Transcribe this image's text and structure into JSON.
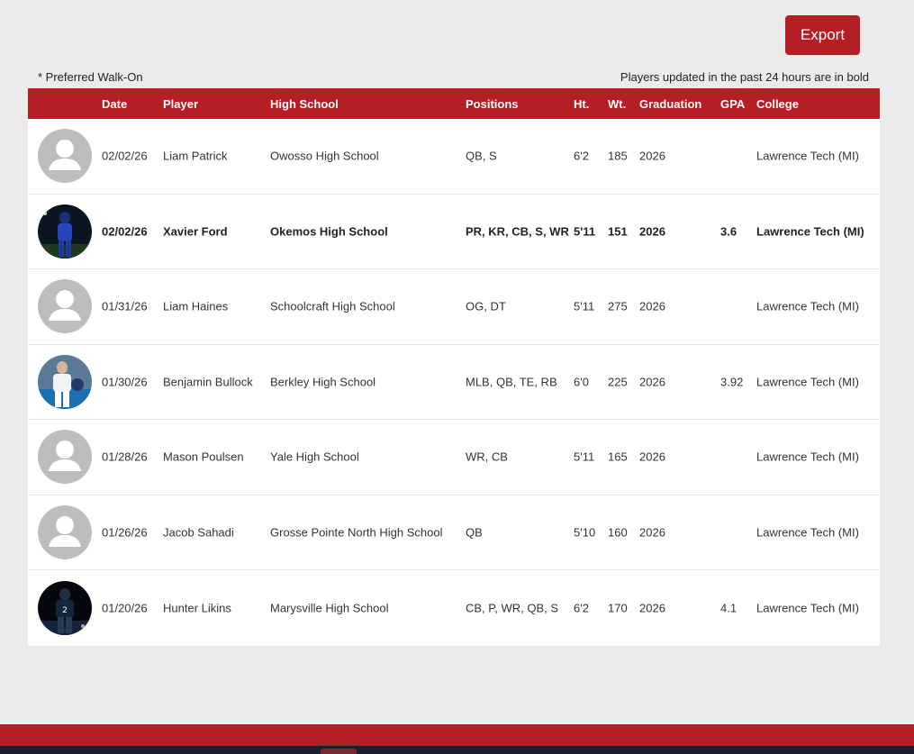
{
  "toolbar": {
    "export_label": "Export"
  },
  "notes": {
    "left": "* Preferred Walk-On",
    "right": "Players updated in the past 24 hours are in bold"
  },
  "table": {
    "headers": {
      "date": "Date",
      "player": "Player",
      "school": "High School",
      "positions": "Positions",
      "ht": "Ht.",
      "wt": "Wt.",
      "graduation": "Graduation",
      "gpa": "GPA",
      "college": "College"
    },
    "rows": [
      {
        "photo": "placeholder",
        "date": "02/02/26",
        "player": "Liam Patrick",
        "school": "Owosso High School",
        "positions": "QB, S",
        "ht": "6'2",
        "wt": "185",
        "graduation": "2026",
        "gpa": "",
        "college": "Lawrence Tech (MI)",
        "bold": false
      },
      {
        "photo": "photo-night-field-blue",
        "date": "02/02/26",
        "player": "Xavier Ford",
        "school": "Okemos High School",
        "positions": "PR, KR, CB, S, WR",
        "ht": "5'11",
        "wt": "151",
        "graduation": "2026",
        "gpa": "3.6",
        "college": "Lawrence Tech (MI)",
        "bold": true
      },
      {
        "photo": "placeholder",
        "date": "01/31/26",
        "player": "Liam Haines",
        "school": "Schoolcraft High School",
        "positions": "OG, DT",
        "ht": "5'11",
        "wt": "275",
        "graduation": "2026",
        "gpa": "",
        "college": "Lawrence Tech (MI)",
        "bold": false
      },
      {
        "photo": "photo-day-white-uniform",
        "date": "01/30/26",
        "player": "Benjamin Bullock",
        "school": "Berkley High School",
        "positions": "MLB, QB, TE, RB",
        "ht": "6'0",
        "wt": "225",
        "graduation": "2026",
        "gpa": "3.92",
        "college": "Lawrence Tech (MI)",
        "bold": false
      },
      {
        "photo": "placeholder",
        "date": "01/28/26",
        "player": "Mason Poulsen",
        "school": "Yale High School",
        "positions": "WR, CB",
        "ht": "5'11",
        "wt": "165",
        "graduation": "2026",
        "gpa": "",
        "college": "Lawrence Tech (MI)",
        "bold": false
      },
      {
        "photo": "placeholder",
        "date": "01/26/26",
        "player": "Jacob Sahadi",
        "school": "Grosse Pointe North High School",
        "positions": "QB",
        "ht": "5'10",
        "wt": "160",
        "graduation": "2026",
        "gpa": "",
        "college": "Lawrence Tech (MI)",
        "bold": false
      },
      {
        "photo": "photo-night-dark-uniform",
        "date": "01/20/26",
        "player": "Hunter Likins",
        "school": "Marysville High School",
        "positions": "CB, P, WR, QB, S",
        "ht": "6'2",
        "wt": "170",
        "graduation": "2026",
        "gpa": "4.1",
        "college": "Lawrence Tech (MI)",
        "bold": false
      }
    ]
  },
  "colors": {
    "accent": "#b31f24",
    "footer_dark": "#1e1f2e",
    "background": "#ebebeb"
  }
}
